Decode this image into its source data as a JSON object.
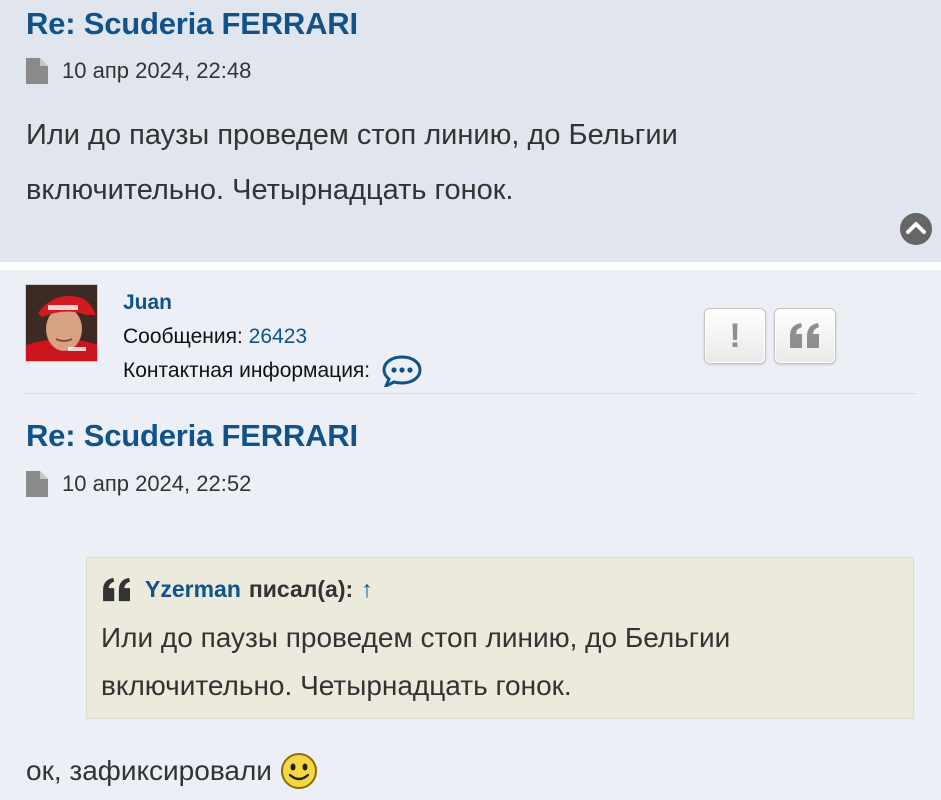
{
  "post1": {
    "title": "Re: Scuderia FERRARI",
    "date": "10 апр 2024, 22:48",
    "lines": [
      "Или до паузы проведем стоп линию, до Бельгии",
      "включительно. Четырнадцать гонок."
    ]
  },
  "post2": {
    "author": {
      "username": "Juan",
      "posts_label": "Сообщения:",
      "posts_count": "26423",
      "contact_label": "Контактная информация:"
    },
    "buttons": {
      "report": "!",
      "quote": "quote"
    },
    "title": "Re: Scuderia FERRARI",
    "date": "10 апр 2024, 22:52",
    "quote": {
      "author": "Yzerman",
      "wrote": "писал(а):",
      "arrow": "↑",
      "lines": [
        "Или до паузы проведем стоп линию, до Бельгии",
        "включительно. Четырнадцать гонок."
      ]
    },
    "reply": "ок, зафиксировали"
  },
  "icons": [
    "file-icon",
    "back-to-top-icon",
    "contact-bubble-icon",
    "report-icon",
    "quote-icon",
    "smiley-icon"
  ],
  "colors": {
    "link": "#105289",
    "post_bg_1": "#e1e6ee",
    "post_bg_2": "#ecf0f6",
    "quote_bg": "#ebeadd"
  }
}
